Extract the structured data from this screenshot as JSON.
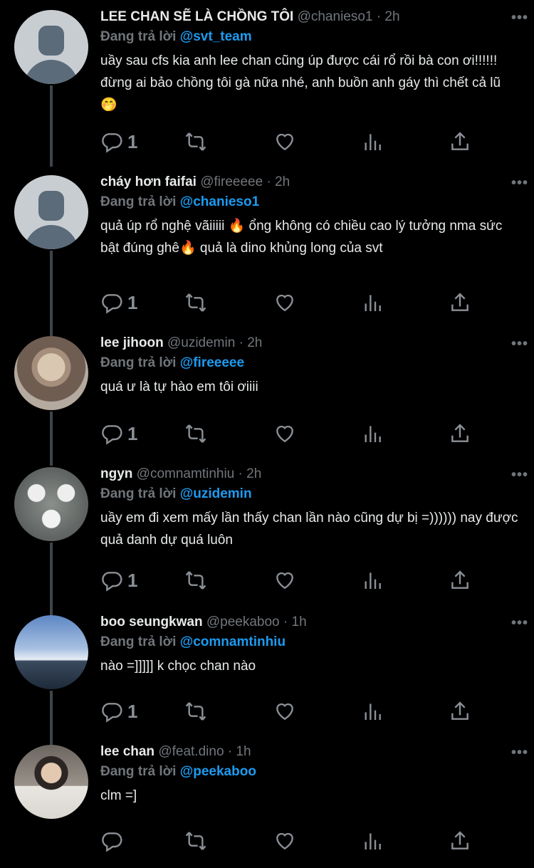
{
  "thread": {
    "tweets": [
      {
        "name": "LEE CHAN SẼ LÀ CHỒNG TÔI",
        "handle": "@chanieso1",
        "time": "2h",
        "reply_prefix": "Đang trả lời",
        "reply_to": "@svt_team",
        "text": "uầy sau cfs kia anh lee chan cũng úp được cái rổ rồi bà con ơi!!!!!! đừng ai bảo chồng tôi gà nữa nhé, anh buồn anh gáy thì chết cả lũ 🤭",
        "reply_count": "1"
      },
      {
        "name": "cháy hơn faifai",
        "handle": "@fireeeee",
        "time": "2h",
        "reply_prefix": "Đang trả lời",
        "reply_to": "@chanieso1",
        "text": "quả úp rổ nghệ vãiiiii 🔥 ổng không có chiều cao lý tưởng nma sức bật đúng ghê🔥 quả là dino khủng long của svt",
        "reply_count": "1"
      },
      {
        "name": "lee jihoon",
        "handle": "@uzidemin",
        "time": "2h",
        "reply_prefix": "Đang trả lời",
        "reply_to": "@fireeeee",
        "text": "quá ư là tự hào em tôi ơiiii",
        "reply_count": "1"
      },
      {
        "name": "ngyn",
        "handle": "@comnamtinhiu",
        "time": "2h",
        "reply_prefix": "Đang trả lời",
        "reply_to": "@uzidemin",
        "text": "uầy em đi xem mấy lần thấy chan lần nào cũng dự bị =)))))) nay được quả danh dự quá luôn",
        "reply_count": "1"
      },
      {
        "name": "boo seungkwan",
        "handle": "@peekaboo",
        "time": "1h",
        "reply_prefix": "Đang trả lời",
        "reply_to": "@comnamtinhiu",
        "text": "nào =]]]]] k chọc chan nào",
        "reply_count": "1"
      },
      {
        "name": "lee chan",
        "handle": "@feat.dino",
        "time": "1h",
        "reply_prefix": "Đang trả lời",
        "reply_to": "@peekaboo",
        "text": "clm =]",
        "reply_count": ""
      }
    ]
  },
  "dot": "·",
  "more_glyph": "•••",
  "colors": {
    "background": "#000000",
    "mention": "#1d9bf0",
    "muted": "#71767b",
    "text": "#e7e9ea"
  }
}
